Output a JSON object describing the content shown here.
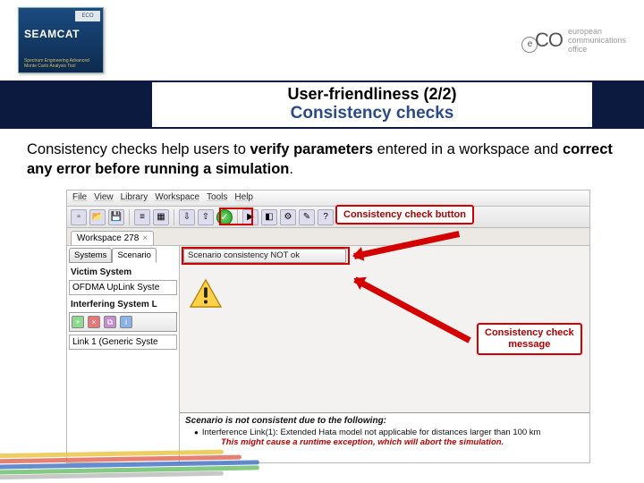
{
  "header": {
    "seamcat": {
      "wordmark": "SEAMCAT",
      "eco_small": "ECO",
      "blurb": "Spectrum Engineering Advanced Monte Carlo Analysis Tool"
    },
    "eco": {
      "mark_letters": "eco",
      "line1": "european",
      "line2": "communications",
      "line3": "office"
    }
  },
  "title": {
    "line1": "User-friendliness (2/2)",
    "line2": "Consistency checks"
  },
  "body": {
    "t1": "Consistency checks help users to ",
    "b1": "verify parameters",
    "t2": " entered in a workspace and ",
    "b2": "correct any error before running a simulation",
    "t3": "."
  },
  "screenshot": {
    "menu": [
      "File",
      "View",
      "Library",
      "Workspace",
      "Tools",
      "Help"
    ],
    "workspace_tab": {
      "label": "Workspace 278",
      "close": "×"
    },
    "sub_tabs": {
      "systems": "Systems",
      "scenario": "Scenario"
    },
    "left": {
      "victim_hdr": "Victim System",
      "victim_val": "OFDMA UpLink Syste",
      "interf_hdr": "Interfering System L",
      "link_val": "Link 1 (Generic Syste"
    },
    "consistency_bar": "Scenario consistency NOT ok",
    "callout_button": "Consistency check button",
    "callout_message_l1": "Consistency check",
    "callout_message_l2": "message",
    "bottom": {
      "hdr": "Scenario is not consistent due to the following:",
      "line": "Interference Link(1): Extended Hata model not applicable for distances larger than 100 km",
      "warn": "This might cause a runtime exception, which will abort the simulation."
    }
  }
}
